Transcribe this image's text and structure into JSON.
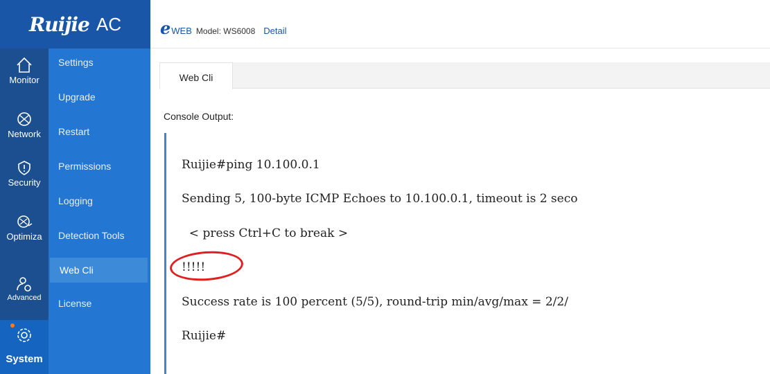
{
  "brand": {
    "name": "Ruijie",
    "suffix": "AC"
  },
  "rail": {
    "items": [
      {
        "label": "Monitor",
        "icon": "home-icon"
      },
      {
        "label": "Network",
        "icon": "globe-icon"
      },
      {
        "label": "Security",
        "icon": "shield-icon"
      },
      {
        "label": "Optimiza",
        "icon": "optimize-icon"
      },
      {
        "label": "Advanced",
        "icon": "user-settings-icon"
      },
      {
        "label": "System",
        "icon": "gear-icon"
      }
    ],
    "active": "System"
  },
  "submenu": {
    "items": [
      {
        "label": "Settings"
      },
      {
        "label": "Upgrade"
      },
      {
        "label": "Restart"
      },
      {
        "label": "Permissions"
      },
      {
        "label": "Logging"
      },
      {
        "label": "Detection Tools"
      },
      {
        "label": "Web Cli"
      },
      {
        "label": "License"
      }
    ],
    "active": "Web Cli"
  },
  "header": {
    "logo_e": "e",
    "logo_web": "WEB",
    "model": "Model: WS6008",
    "detail": "Detail"
  },
  "tabs": [
    {
      "label": "Web Cli"
    }
  ],
  "console": {
    "label": "Console Output:",
    "lines": [
      "Ruijie#ping 10.100.0.1",
      "Sending 5, 100-byte ICMP Echoes to 10.100.0.1, timeout is 2 seco",
      "  < press Ctrl+C to break >",
      "!!!!!",
      "Success rate is 100 percent (5/5), round-trip min/avg/max = 2/2/",
      "Ruijie#"
    ]
  },
  "colors": {
    "rail": "#1b4f8f",
    "submenu": "#2376d1",
    "accent": "#1a56a8",
    "annotation": "#e02020",
    "notify_dot": "#ff7a1a"
  }
}
